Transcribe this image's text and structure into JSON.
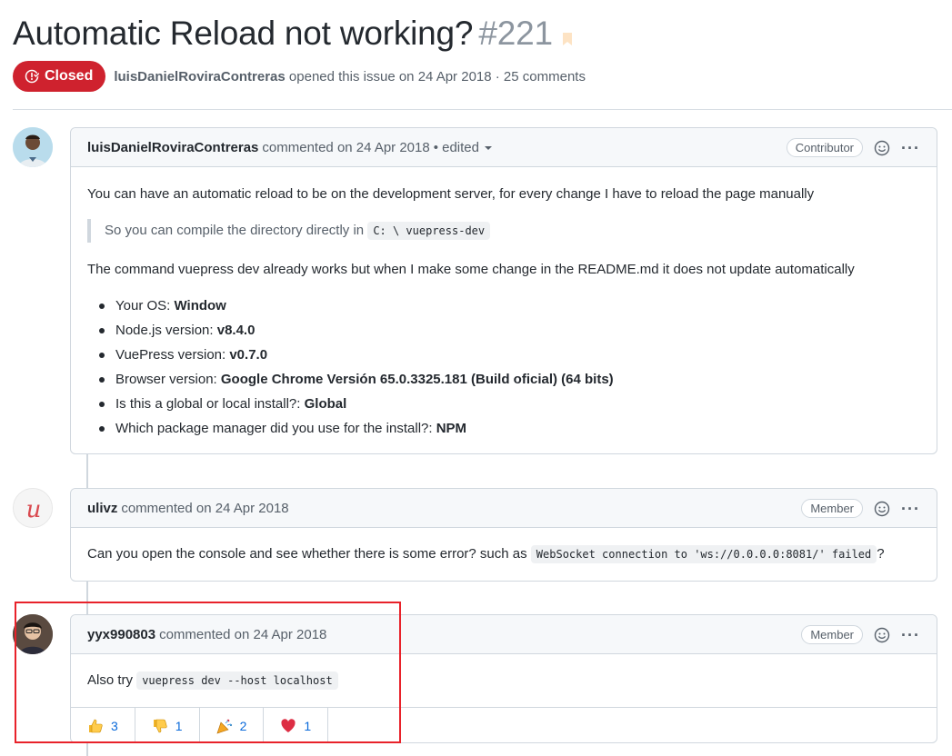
{
  "issue": {
    "title": "Automatic Reload not working?",
    "number": "#221",
    "state": "Closed",
    "author": "luisDanielRoviraContreras",
    "meta_suffix": "opened this issue on 24 Apr 2018 · 25 comments"
  },
  "comments": [
    {
      "author": "luisDanielRoviraContreras",
      "action": "commented on 24 Apr 2018",
      "edited": "• edited",
      "role": "Contributor",
      "intro": "You can have an automatic reload to be on the development server, for every change I have to reload the page manually",
      "quote_text": "So you can compile the directory directly in",
      "quote_code": "C: \\ vuepress-dev",
      "paragraph": "The command vuepress dev already works but when I make some change in the README.md it does not update automatically",
      "list": [
        {
          "label": "Your OS:",
          "value": "Window"
        },
        {
          "label": "Node.js version:",
          "value": "v8.4.0"
        },
        {
          "label": "VuePress version:",
          "value": "v0.7.0"
        },
        {
          "label": "Browser version:",
          "value": "Google Chrome Versión 65.0.3325.181 (Build oficial) (64 bits)"
        },
        {
          "label": "Is this a global or local install?:",
          "value": "Global"
        },
        {
          "label": "Which package manager did you use for the install?:",
          "value": "NPM"
        }
      ]
    },
    {
      "author": "ulivz",
      "action": "commented on 24 Apr 2018",
      "role": "Member",
      "text": "Can you open the console and see whether there is some error? such as",
      "code": "WebSocket connection to 'ws://0.0.0.0:8081/' failed",
      "after": "?"
    },
    {
      "author": "yyx990803",
      "action": "commented on 24 Apr 2018",
      "role": "Member",
      "text": "Also try",
      "code": "vuepress dev --host localhost",
      "reactions": [
        {
          "icon": "thumbs-up-icon",
          "count": "3"
        },
        {
          "icon": "thumbs-down-icon",
          "count": "1"
        },
        {
          "icon": "tada-icon",
          "count": "2"
        },
        {
          "icon": "heart-icon",
          "count": "1"
        }
      ]
    }
  ],
  "colors": {
    "closed": "#cf222e",
    "highlight": "#e8222a",
    "link": "#0969da"
  }
}
